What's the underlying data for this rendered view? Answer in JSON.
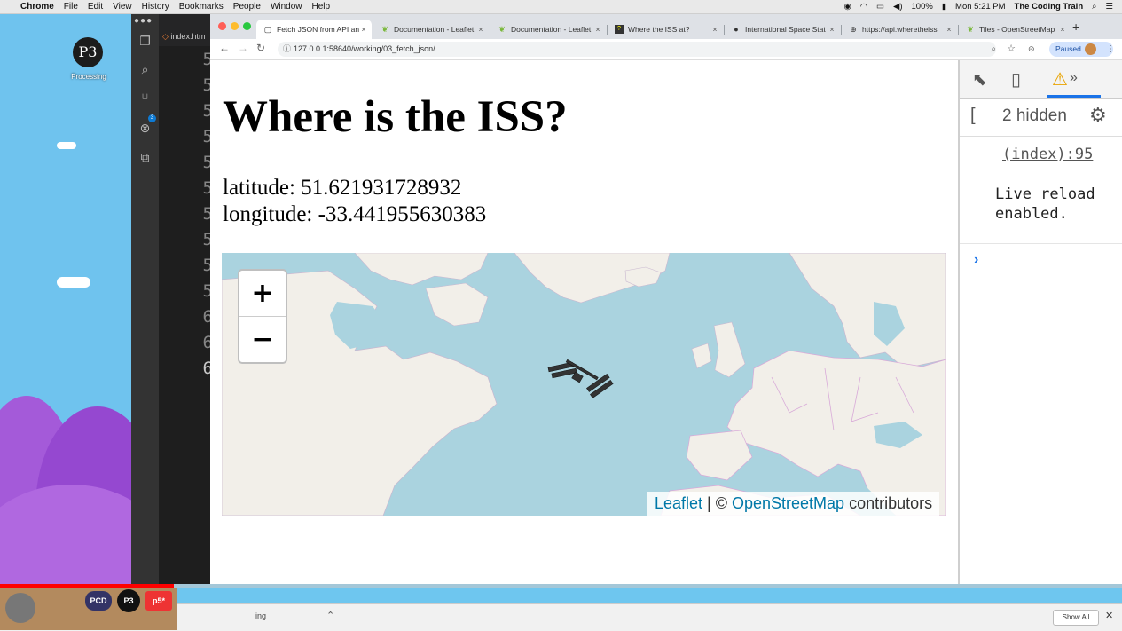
{
  "menubar": {
    "app": "Chrome",
    "items": [
      "File",
      "Edit",
      "View",
      "History",
      "Bookmarks",
      "People",
      "Window",
      "Help"
    ],
    "battery": "100%",
    "clock": "Mon 5:21 PM",
    "user": "The Coding Train"
  },
  "desktop": {
    "processing_label": "Processing",
    "processing_glyph": "P3"
  },
  "vscode": {
    "tab": "index.htm",
    "scm_badge": "3",
    "line_numbers": [
      "5",
      "5",
      "5",
      "5",
      "5",
      "5",
      "5",
      "5",
      "5",
      "5",
      "6",
      "6",
      "6"
    ]
  },
  "browser": {
    "tabs": [
      {
        "title": "Fetch JSON from API an",
        "icon": "page-icon",
        "active": true
      },
      {
        "title": "Documentation - Leaflet",
        "icon": "leaflet-icon"
      },
      {
        "title": "Documentation - Leaflet",
        "icon": "leaflet-icon"
      },
      {
        "title": "Where the ISS at?",
        "icon": "iss-favicon"
      },
      {
        "title": "International Space Stat",
        "icon": "github-icon"
      },
      {
        "title": "https://api.wheretheiss",
        "icon": "globe-icon"
      },
      {
        "title": "Tiles - OpenStreetMap",
        "icon": "leaflet-icon"
      }
    ],
    "url": "127.0.0.1:58640/working/03_fetch_json/",
    "paused_label": "Paused"
  },
  "page": {
    "title": "Where is the ISS?",
    "latitude_label": "latitude: ",
    "latitude": "51.621931728932",
    "longitude_label": "longitude: ",
    "longitude": "-33.441955630383",
    "map": {
      "zoom_in": "+",
      "zoom_out": "−",
      "attribution_leaflet": "Leaflet",
      "attribution_sep": " | © ",
      "attribution_osm": "OpenStreetMap",
      "attribution_tail": " contributors",
      "water_color": "#aad3df",
      "land_color": "#f2efe9"
    }
  },
  "devtools": {
    "hidden_count": "2 hidden",
    "source_link": "(index):95",
    "message": "Live reload enabled."
  },
  "downloads": {
    "item": "ing",
    "show_all": "Show All"
  },
  "video": {
    "progress_fraction": 0.155
  }
}
